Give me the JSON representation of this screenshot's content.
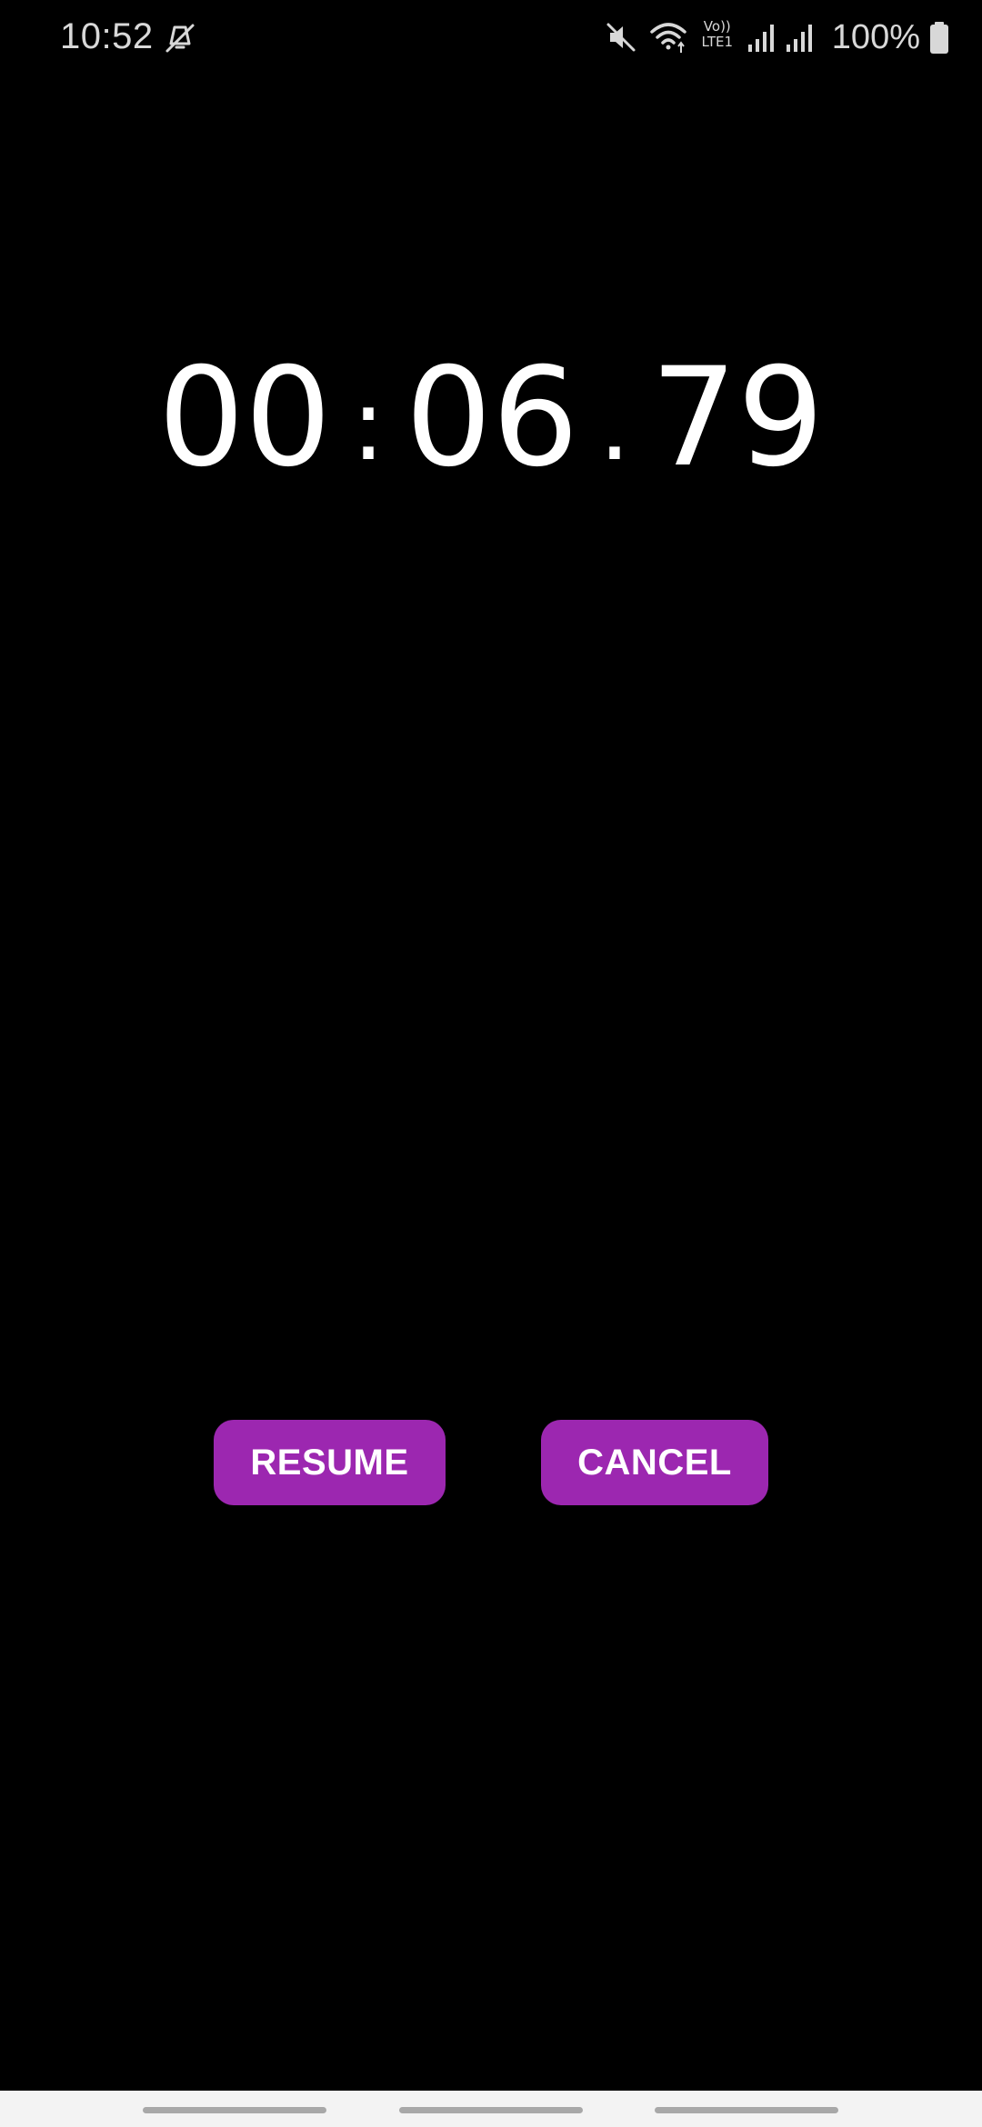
{
  "status_bar": {
    "time": "10:52",
    "battery_percent": "100%",
    "volte_top": "Vo))",
    "volte_bottom": "LTE1",
    "icons": [
      "dnd-off-icon",
      "mute-icon",
      "wifi-icon",
      "volte-lte-icon",
      "signal-icon",
      "signal-icon",
      "battery-icon"
    ]
  },
  "stopwatch": {
    "minutes": "00",
    "colon": ":",
    "seconds": "06",
    "dot": ".",
    "hundredths": "79"
  },
  "actions": {
    "resume_label": "RESUME",
    "cancel_label": "CANCEL"
  },
  "theme": {
    "background": "#000000",
    "accent": "#9c27b0",
    "text": "#ffffff",
    "status_text": "#d8d8d8"
  }
}
